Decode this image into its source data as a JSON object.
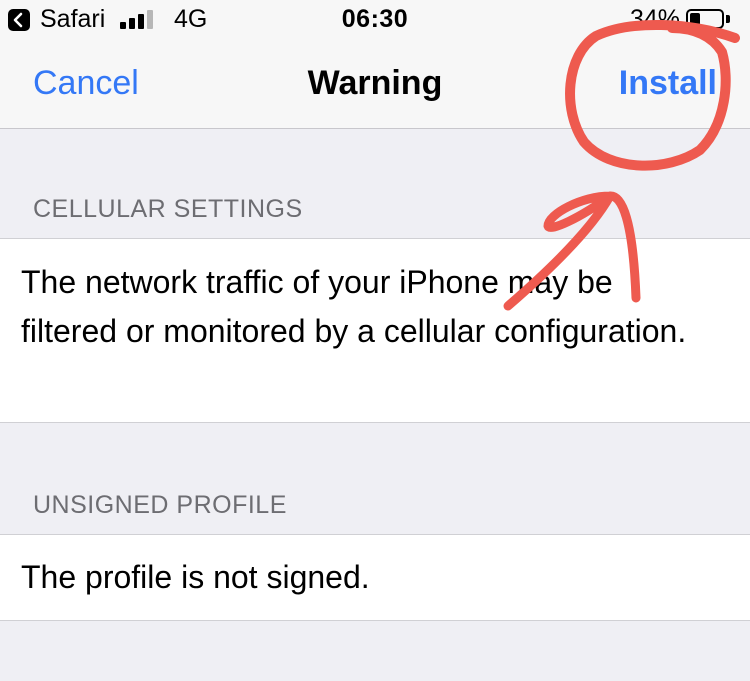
{
  "status_bar": {
    "back_app": "Safari",
    "network": "4G",
    "time": "06:30",
    "battery_percent": "34%",
    "battery_level": 0.34,
    "icons": [
      "back-arrow-icon",
      "signal-bars-icon",
      "battery-icon"
    ]
  },
  "nav": {
    "cancel_label": "Cancel",
    "title": "Warning",
    "install_label": "Install"
  },
  "sections": [
    {
      "header": "CELLULAR SETTINGS",
      "text": "The network traffic of your iPhone may be filtered or monitored by a cellular configuration."
    },
    {
      "header": "UNSIGNED PROFILE",
      "text": "The profile is not signed."
    }
  ],
  "annotation": {
    "color": "#ee5a4f",
    "icons": [
      "hand-drawn-circle-icon",
      "hand-drawn-arrow-icon"
    ]
  },
  "colors": {
    "accent": "#3478f6",
    "background": "#efeff4",
    "header_text": "#6d6d72"
  }
}
